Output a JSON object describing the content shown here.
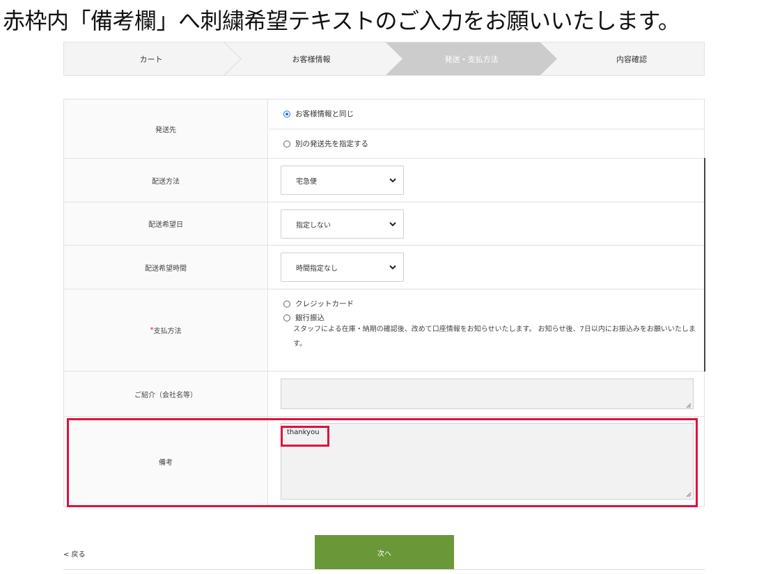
{
  "headline": "赤枠内「備考欄」へ刺繍希望テキストのご入力をお願いいたします。",
  "steps": {
    "items": [
      "カート",
      "お客様情報",
      "発送・支払方法",
      "内容確認"
    ],
    "active_index": 2,
    "active_color": "#cccccc"
  },
  "shipping_destination": {
    "label": "発送先",
    "options": [
      {
        "label": "お客様情報と同じ",
        "checked": true
      },
      {
        "label": "別の発送先を指定する",
        "checked": false
      }
    ]
  },
  "delivery_method": {
    "label": "配送方法",
    "selected": "宅急便"
  },
  "delivery_date": {
    "label": "配送希望日",
    "selected": "指定しない"
  },
  "delivery_time": {
    "label": "配送希望時間",
    "selected": "時間指定なし"
  },
  "payment": {
    "required_mark": "*",
    "label": "支払方法",
    "options": [
      {
        "label": "クレジットカード",
        "checked": false
      },
      {
        "label": "銀行振込",
        "checked": false
      }
    ],
    "note": "スタッフによる在庫・納期の確認後、改めて口座情報をお知らせいたします。 お知らせ後、7日以内にお振込みをお願いいたします。"
  },
  "referral": {
    "label": "ご紹介（会社名等）",
    "value": ""
  },
  "remarks": {
    "label": "備考",
    "value": "thankyou"
  },
  "footer": {
    "back_label": "< 戻る",
    "next_label": "次へ"
  },
  "colors": {
    "accent_red": "#e0103c",
    "next_button": "#6a9838",
    "radio_checked": "#1a73e8"
  }
}
